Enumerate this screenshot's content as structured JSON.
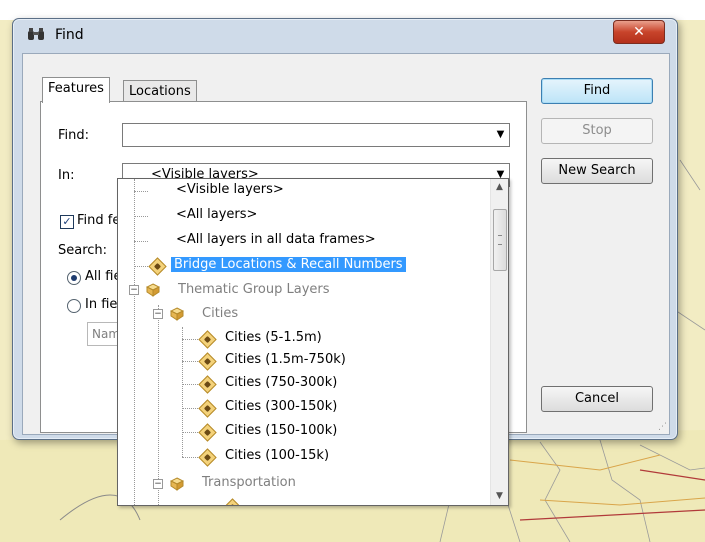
{
  "window": {
    "title": "Find",
    "close_label": "✕"
  },
  "tabs": [
    {
      "label": "Features"
    },
    {
      "label": "Locations"
    }
  ],
  "form": {
    "find_label": "Find:",
    "find_value": "",
    "in_label": "In:",
    "in_value": "<Visible layers>",
    "find_fields_partial": "Find fe",
    "search_label": "Search:",
    "all_fields_partial": "All fie",
    "in_field_partial": "In fiel",
    "name_partial": "Nam"
  },
  "buttons": {
    "find": "Find",
    "stop": "Stop",
    "new_search": "New Search",
    "cancel": "Cancel"
  },
  "dropdown": {
    "items": [
      {
        "label": "<Visible layers>"
      },
      {
        "label": "<All layers>"
      },
      {
        "label": "<All layers in all data frames>"
      },
      {
        "label": "Bridge Locations & Recall Numbers"
      },
      {
        "label": "Thematic Group Layers"
      },
      {
        "label": "Cities"
      },
      {
        "label": "Cities (5-1.5m)"
      },
      {
        "label": "Cities (1.5m-750k)"
      },
      {
        "label": "Cities (750-300k)"
      },
      {
        "label": "Cities (300-150k)"
      },
      {
        "label": "Cities (150-100k)"
      },
      {
        "label": "Cities (100-15k)"
      },
      {
        "label": "Transportation"
      }
    ],
    "selected_index": 3
  },
  "colors": {
    "selection": "#3399ff",
    "map_background": "#f2ecc3",
    "layer_icon": "#f4d27a"
  },
  "icons": {
    "title": "binoculars-icon",
    "layer": "point-layer-icon",
    "group": "group-layer-icon"
  }
}
